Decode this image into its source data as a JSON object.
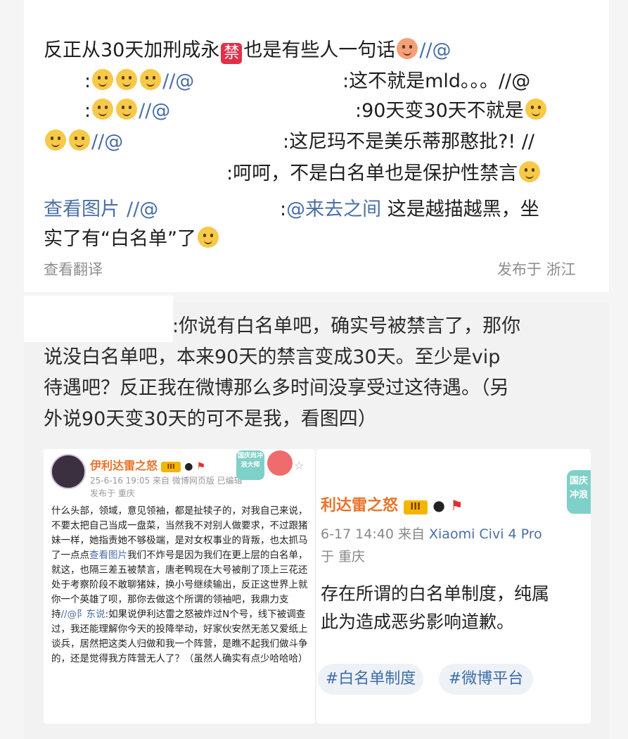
{
  "comment1": {
    "line1": "反正从30天加刑成永",
    "ban_glyph": "禁",
    "line1b": "也是有些人一句话",
    "line1c": "//@",
    "line2a": ":",
    "line2b": "//@",
    "line2c": ":这不就是mld。。。//@",
    "line3a": ":",
    "line3b": "//@",
    "line3c": ":90天变30天不就是",
    "line4b": "//@",
    "line4c": ":这尼玛不是美乐蒂那憨批?! //",
    "line5": ":呵呵，不是白名单也是保护性禁言",
    "line6a": "查看图片",
    "line6b": "//@",
    "line6c": ":",
    "line6d": "@来去之间",
    "line6e": "这是越描越黑，坐",
    "line7": "实了有“白名单”了",
    "translate": "查看翻译",
    "location": "发布于 浙江"
  },
  "comment2": {
    "line1": ":你说有白名单吧，确实号被禁言了，那你",
    "line2": "说没白名单吧，本来90天的禁言变成30天。至少是vip",
    "line3": "待遇吧？反正我在微博那么多时间没享受过这待遇。（另",
    "line4": "外说90天变30天的可不是我，看图四）"
  },
  "screenshot1": {
    "username": "伊利达雷之怒",
    "level": "III",
    "meta": "25-6-16 19:05  来自 微博网页版  已编辑",
    "location": "发布于 重庆",
    "badge": "国庆尚冲浪大师",
    "body": "什么头部，领域，意见领袖，都是扯犊子的，对我自己来说，不要太把自己当成一盘菜，当然我不对别人做要求，不过跟猪妹一样，她指责她不够极端，是对女权事业的背叛，也太抓马了一点点",
    "link": "查看图片",
    "body2": "我们不炸号是因为我们在更上层的白名单，就这，也隔三差五被禁言，唐老鸭现在大号被削了顶上三花还处于考察阶段不敢聊猪妹，换小号继续输出，反正这世界上就你一个英雄了呗，那你去做这个所谓的领袖吧，我鼎力支持",
    "repost": "//@阝东说",
    "body3": ":如果说伊利达雷之怒被炸过N个号，线下被调查过，我还能理解你今天的投降举动，好家伙安然无恙又爱纸上谈兵，居然把这类人归做和我一个阵营，是瞧不起我们做斗争的，还是觉得我方阵营无人了？（虽然人确实有点少哈哈哈）"
  },
  "screenshot2": {
    "username": "利达雷之怒",
    "level": "III",
    "meta_time": "6-17 14:40  来自",
    "meta_device": "Xiaomi Civi 4 Pro",
    "location": "于 重庆",
    "line1": "存在所谓的白名单制度，纯属",
    "line2": "此为造成恶劣影响道歉。",
    "badge": "国庆冲浪",
    "tags": [
      "#白名单制度",
      "#微博平台"
    ]
  },
  "colors": {
    "link_blue": "#4a6fa5",
    "username_orange": "#e8742c",
    "ban_red": "#e0314a",
    "tag_bg": "#eef2f7"
  }
}
